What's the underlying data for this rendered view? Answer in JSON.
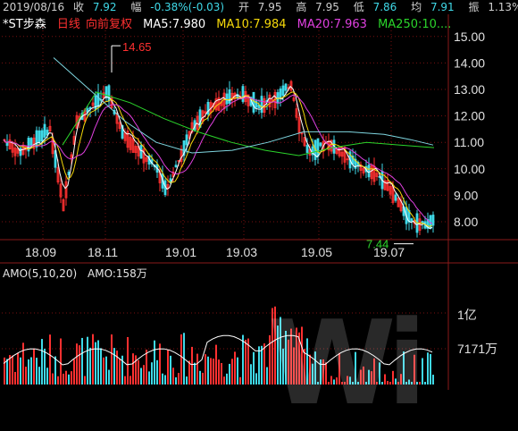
{
  "header": {
    "date": "2019/08/16",
    "close_label": "收",
    "close": "7.92",
    "change_label": "幅",
    "change": "-0.38%(-0.03)",
    "open_label": "开",
    "open": "7.95",
    "high_label": "高",
    "high": "7.95",
    "low_label": "低",
    "low": "7.86",
    "avg_label": "均",
    "avg": "7.91",
    "amplitude_label": "振",
    "amplitude": "1.13%"
  },
  "ma_bar": {
    "stock_name": "*ST步森",
    "period": "日线",
    "adjust": "向前复权",
    "ma5": "MA5:7.980",
    "ma10": "MA10:7.984",
    "ma20": "MA20:7.963",
    "ma250": "MA250:10...."
  },
  "colors": {
    "up": "#ff3030",
    "down": "#3fd9e8",
    "ma5": "#ffffff",
    "ma10": "#f5d90a",
    "ma20": "#e040e0",
    "ma250": "#2bd42b",
    "grid": "#7a1010",
    "axis_text": "#e0e0e0"
  },
  "price_axis": {
    "labels": [
      "15.00",
      "14.00",
      "13.00",
      "12.00",
      "11.00",
      "10.00",
      "9.00",
      "8.00"
    ]
  },
  "date_axis": {
    "labels": [
      "18.09",
      "18.11",
      "19.01",
      "19.03",
      "19.05",
      "19.07"
    ]
  },
  "annotations": {
    "high_mark": "14.65",
    "low_mark": "7.44"
  },
  "amo_bar": {
    "title": "AMO(5,10,20)",
    "value": "AMO:158万"
  },
  "volume_axis": {
    "labels": [
      "1亿",
      "7171万"
    ]
  },
  "watermark": "Wi",
  "chart_data": {
    "type": "line",
    "title": "*ST步森",
    "ylim": [
      7.3,
      15.2
    ],
    "series": [
      {
        "name": "MA250",
        "values": [
          10.9,
          12.9,
          12.5,
          11.9,
          11.4,
          11.0,
          10.7,
          10.5,
          10.8,
          11.0,
          10.9,
          10.8
        ]
      },
      {
        "name": "MA20",
        "values": [
          10.4,
          10.6,
          11.8,
          10.5,
          10.7,
          12.0,
          12.5,
          12.9,
          11.2,
          10.2,
          8.8,
          7.96
        ]
      }
    ]
  }
}
